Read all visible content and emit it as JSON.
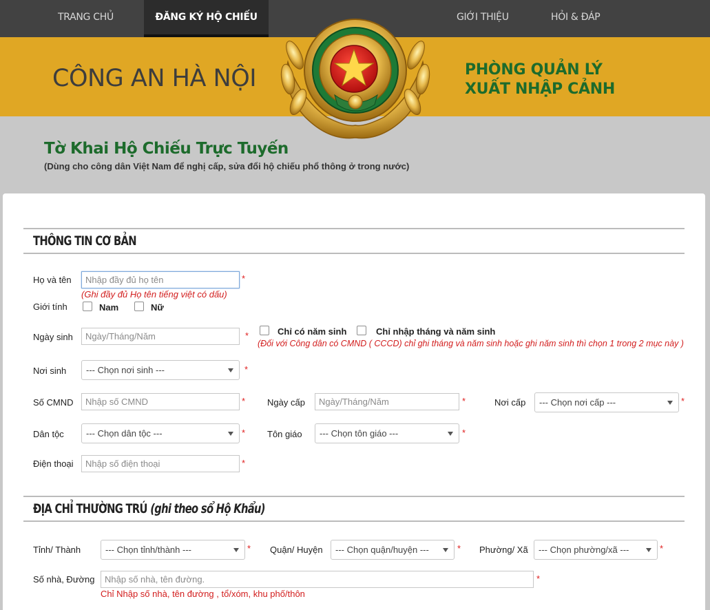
{
  "nav": {
    "home": "TRANG CHỦ",
    "register": "ĐĂNG KÝ HỘ CHIẾU",
    "about": "GIỚI THIỆU",
    "faq": "HỎI & ĐÁP"
  },
  "banner": {
    "left": "CÔNG AN HÀ NỘI",
    "right_line1": "PHÒNG QUẢN LÝ",
    "right_line2": "XUẤT NHẬP CẢNH"
  },
  "header": {
    "title": "Tờ Khai Hộ Chiếu Trực Tuyến",
    "subtitle": "(Dùng cho công dân Việt Nam để nghị cấp, sửa đổi hộ chiếu phổ thông ở trong nước)"
  },
  "basic": {
    "heading": "THÔNG TIN CƠ BẢN",
    "fullname_label": "Họ và tên",
    "fullname_placeholder": "Nhập đầy đủ họ tên",
    "fullname_hint": "(Ghi đầy đủ Họ tên tiếng việt có dấu)",
    "gender_label": "Giới tính",
    "male": "Nam",
    "female": "Nữ",
    "dob_label": "Ngày sinh",
    "dob_placeholder": "Ngày/Tháng/Năm",
    "year_only": "Chỉ có năm sinh",
    "month_year": "Chỉ nhập tháng và năm sinh",
    "dob_hint": "(Đối với Công dân có CMND ( CCCD) chỉ ghi tháng và năm sinh hoặc ghi năm sinh thì chọn 1 trong 2 mục này )",
    "birthplace_label": "Nơi sinh",
    "birthplace_value": "--- Chọn nơi sinh ---",
    "id_label": "Số CMND",
    "id_placeholder": "Nhập số CMND",
    "issue_date_label": "Ngày cấp",
    "issue_date_placeholder": "Ngày/Tháng/Năm",
    "issue_place_label": "Nơi cấp",
    "issue_place_value": "--- Chọn nơi cấp ---",
    "ethnic_label": "Dân tộc",
    "ethnic_value": "--- Chọn dân tộc ---",
    "religion_label": "Tôn giáo",
    "religion_value": "--- Chọn tôn giáo ---",
    "phone_label": "Điện thoại",
    "phone_placeholder": "Nhập số điện thoại",
    "required": "*"
  },
  "address": {
    "heading": "ĐỊA CHỈ THƯỜNG TRÚ",
    "heading_note": "(ghi theo sổ Hộ Khẩu)",
    "province_label": "Tỉnh/ Thành",
    "province_value": "--- Chọn tỉnh/thành ---",
    "district_label": "Quận/ Huyện",
    "district_value": "--- Chọn quận/huyện ---",
    "ward_label": "Phường/ Xã",
    "ward_value": "--- Chọn phường/xã ---",
    "street_label": "Số nhà, Đường",
    "street_placeholder": "Nhập số nhà, tên đường.",
    "street_hint": "Chỉ Nhập số nhà, tên đường , tổ/xóm, khu phố/thôn"
  }
}
